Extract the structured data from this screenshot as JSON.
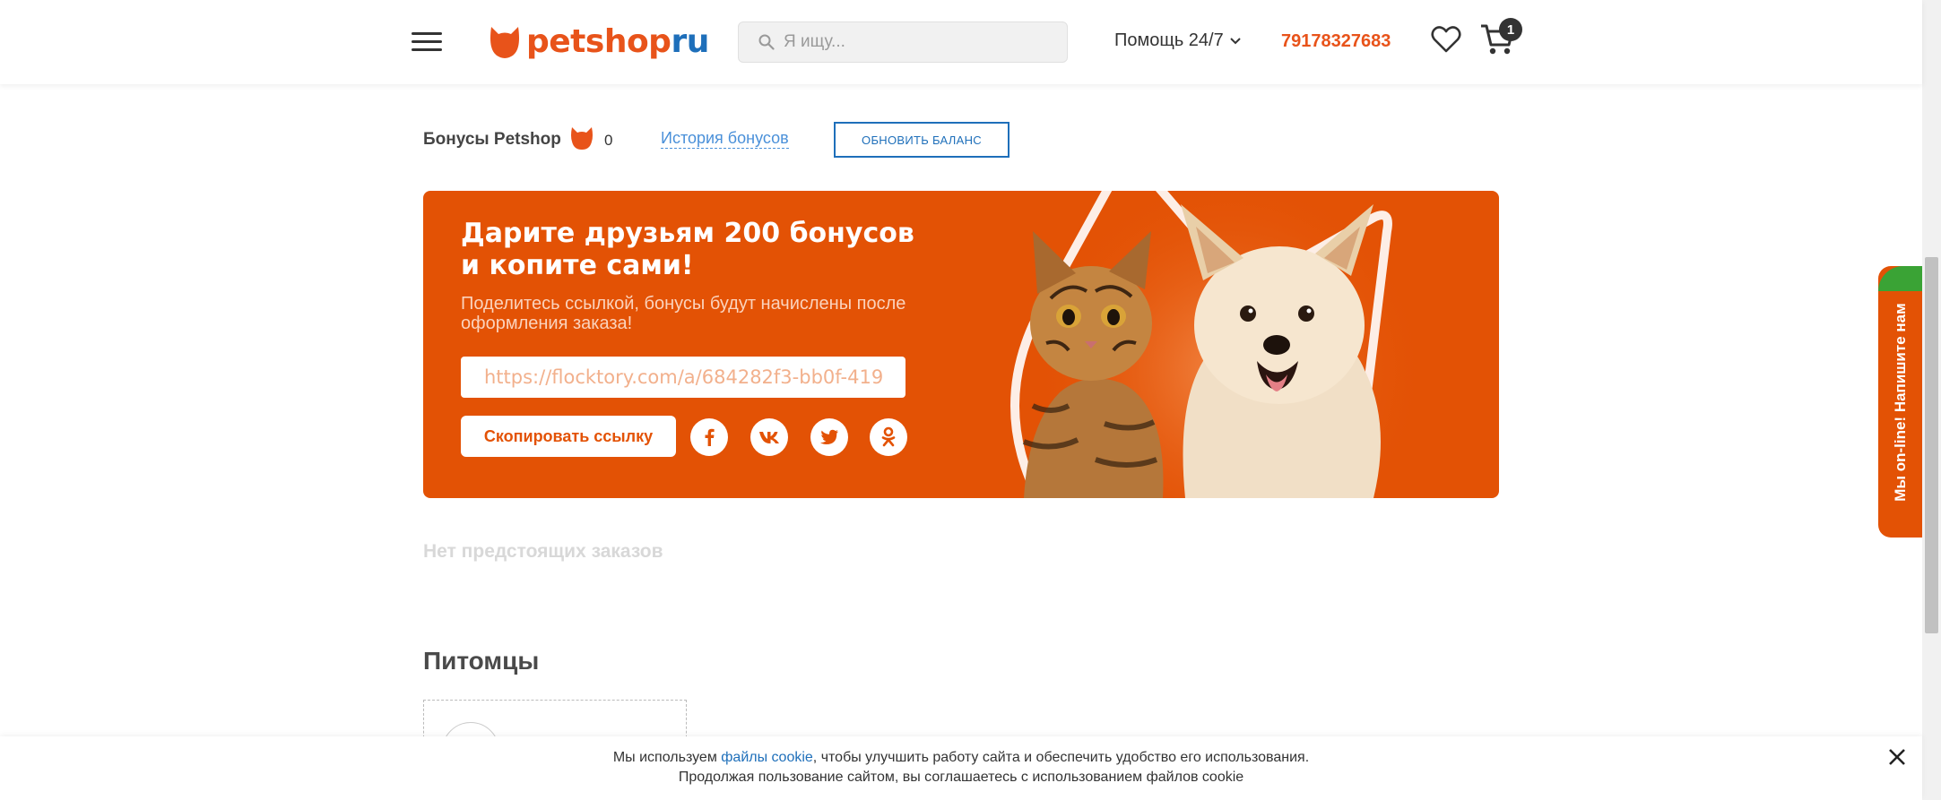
{
  "header": {
    "logo": {
      "part1": "petshop",
      "part2": "ru"
    },
    "search_placeholder": "Я ищу...",
    "help_label": "Помощь 24/7",
    "phone": "79178327683",
    "cart_count": "1"
  },
  "bonuses": {
    "title": "Бонусы Petshop",
    "count": "0",
    "history_link": "История бонусов",
    "refresh_button": "ОБНОВИТЬ БАЛАНС"
  },
  "banner": {
    "title_part1": "Дарите друзьям ",
    "title_bold": "200 бонусов",
    "title_part2": "и копите сами!",
    "subtitle": "Поделитесь ссылкой, бонусы будут начислены после оформления заказа!",
    "referral_link": "https://flocktory.com/a/684282f3-bb0f-419",
    "copy_button": "Скопировать ссылку",
    "social": [
      "facebook",
      "vk",
      "twitter",
      "odnoklassniki"
    ]
  },
  "orders": {
    "empty_text": "Нет предстоящих заказов"
  },
  "pets": {
    "title": "Питомцы"
  },
  "chat": {
    "label": "Мы on-line! Напишите нам"
  },
  "cookie": {
    "text_before": "Мы используем ",
    "link": "файлы cookie",
    "text_after": ", чтобы улучшить работу сайта и обеспечить удобство его использования.",
    "line2": "Продолжая пользование сайтом, вы соглашаетесь с использованием файлов cookie"
  },
  "colors": {
    "brand_orange": "#e35205",
    "brand_blue": "#1e6fba"
  }
}
